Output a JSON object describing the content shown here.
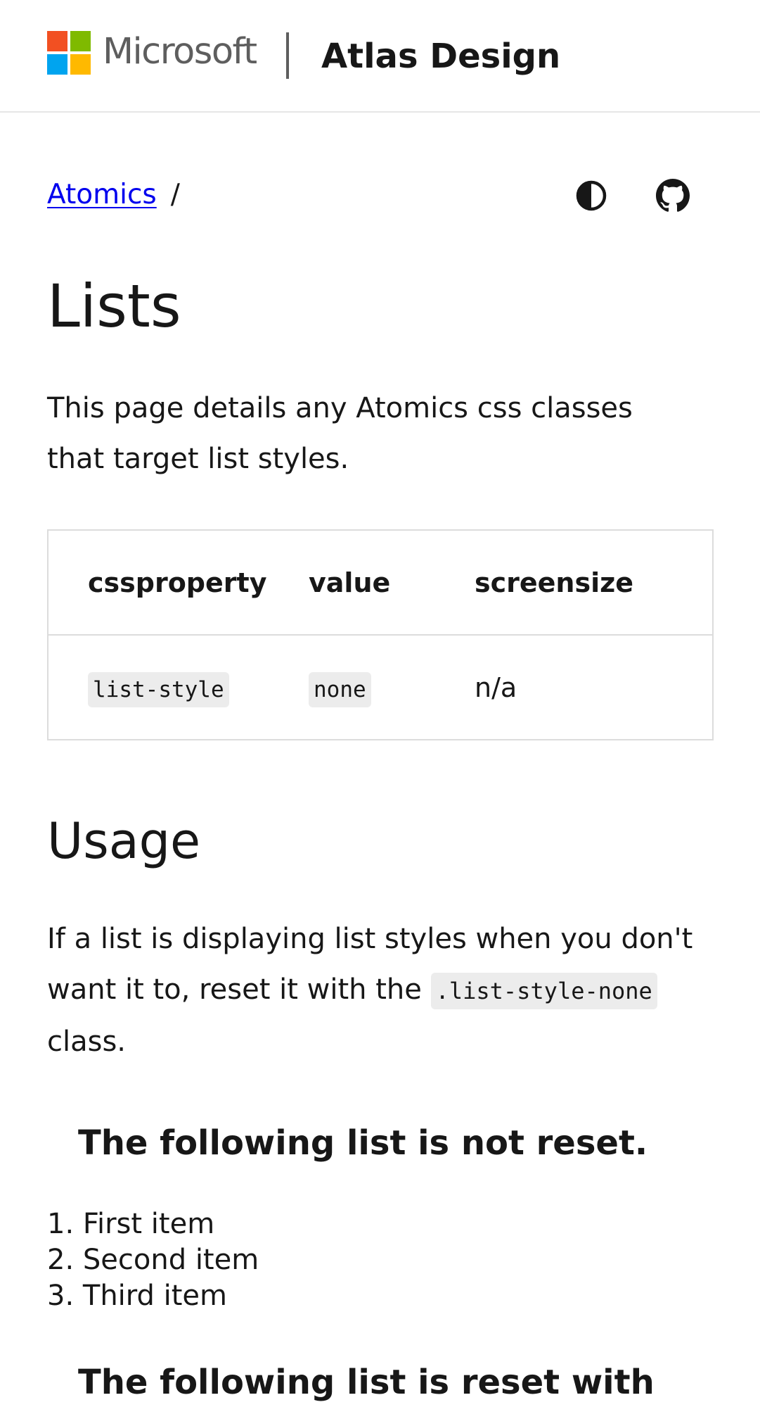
{
  "header": {
    "brand": "Microsoft",
    "site_title": "Atlas Design",
    "logo_colors": [
      "#f25022",
      "#7fba00",
      "#00a4ef",
      "#ffb900"
    ]
  },
  "breadcrumb": {
    "link": "Atomics",
    "separator": "/"
  },
  "toolbar": {
    "theme_icon": "contrast-icon",
    "github_icon": "github-icon"
  },
  "page": {
    "title": "Lists",
    "intro": "This page details any Atomics css classes that target list styles."
  },
  "table": {
    "headers": [
      "cssproperty",
      "value",
      "screensize"
    ],
    "rows": [
      [
        "list-style",
        "none",
        "n/a"
      ]
    ]
  },
  "usage": {
    "heading": "Usage",
    "text_before": "If a list is displaying list styles when you don't want it to, reset it with the ",
    "code": ".list-style-none",
    "text_after": " class."
  },
  "example1": {
    "heading": "The following list is not reset.",
    "items": [
      "First item",
      "Second item",
      "Third item"
    ]
  },
  "example2": {
    "heading": "The following list is reset with"
  },
  "colors": {
    "text": "#171717",
    "link": "#0000ee",
    "border": "#dcdcdc",
    "code_bg": "#ececec"
  }
}
